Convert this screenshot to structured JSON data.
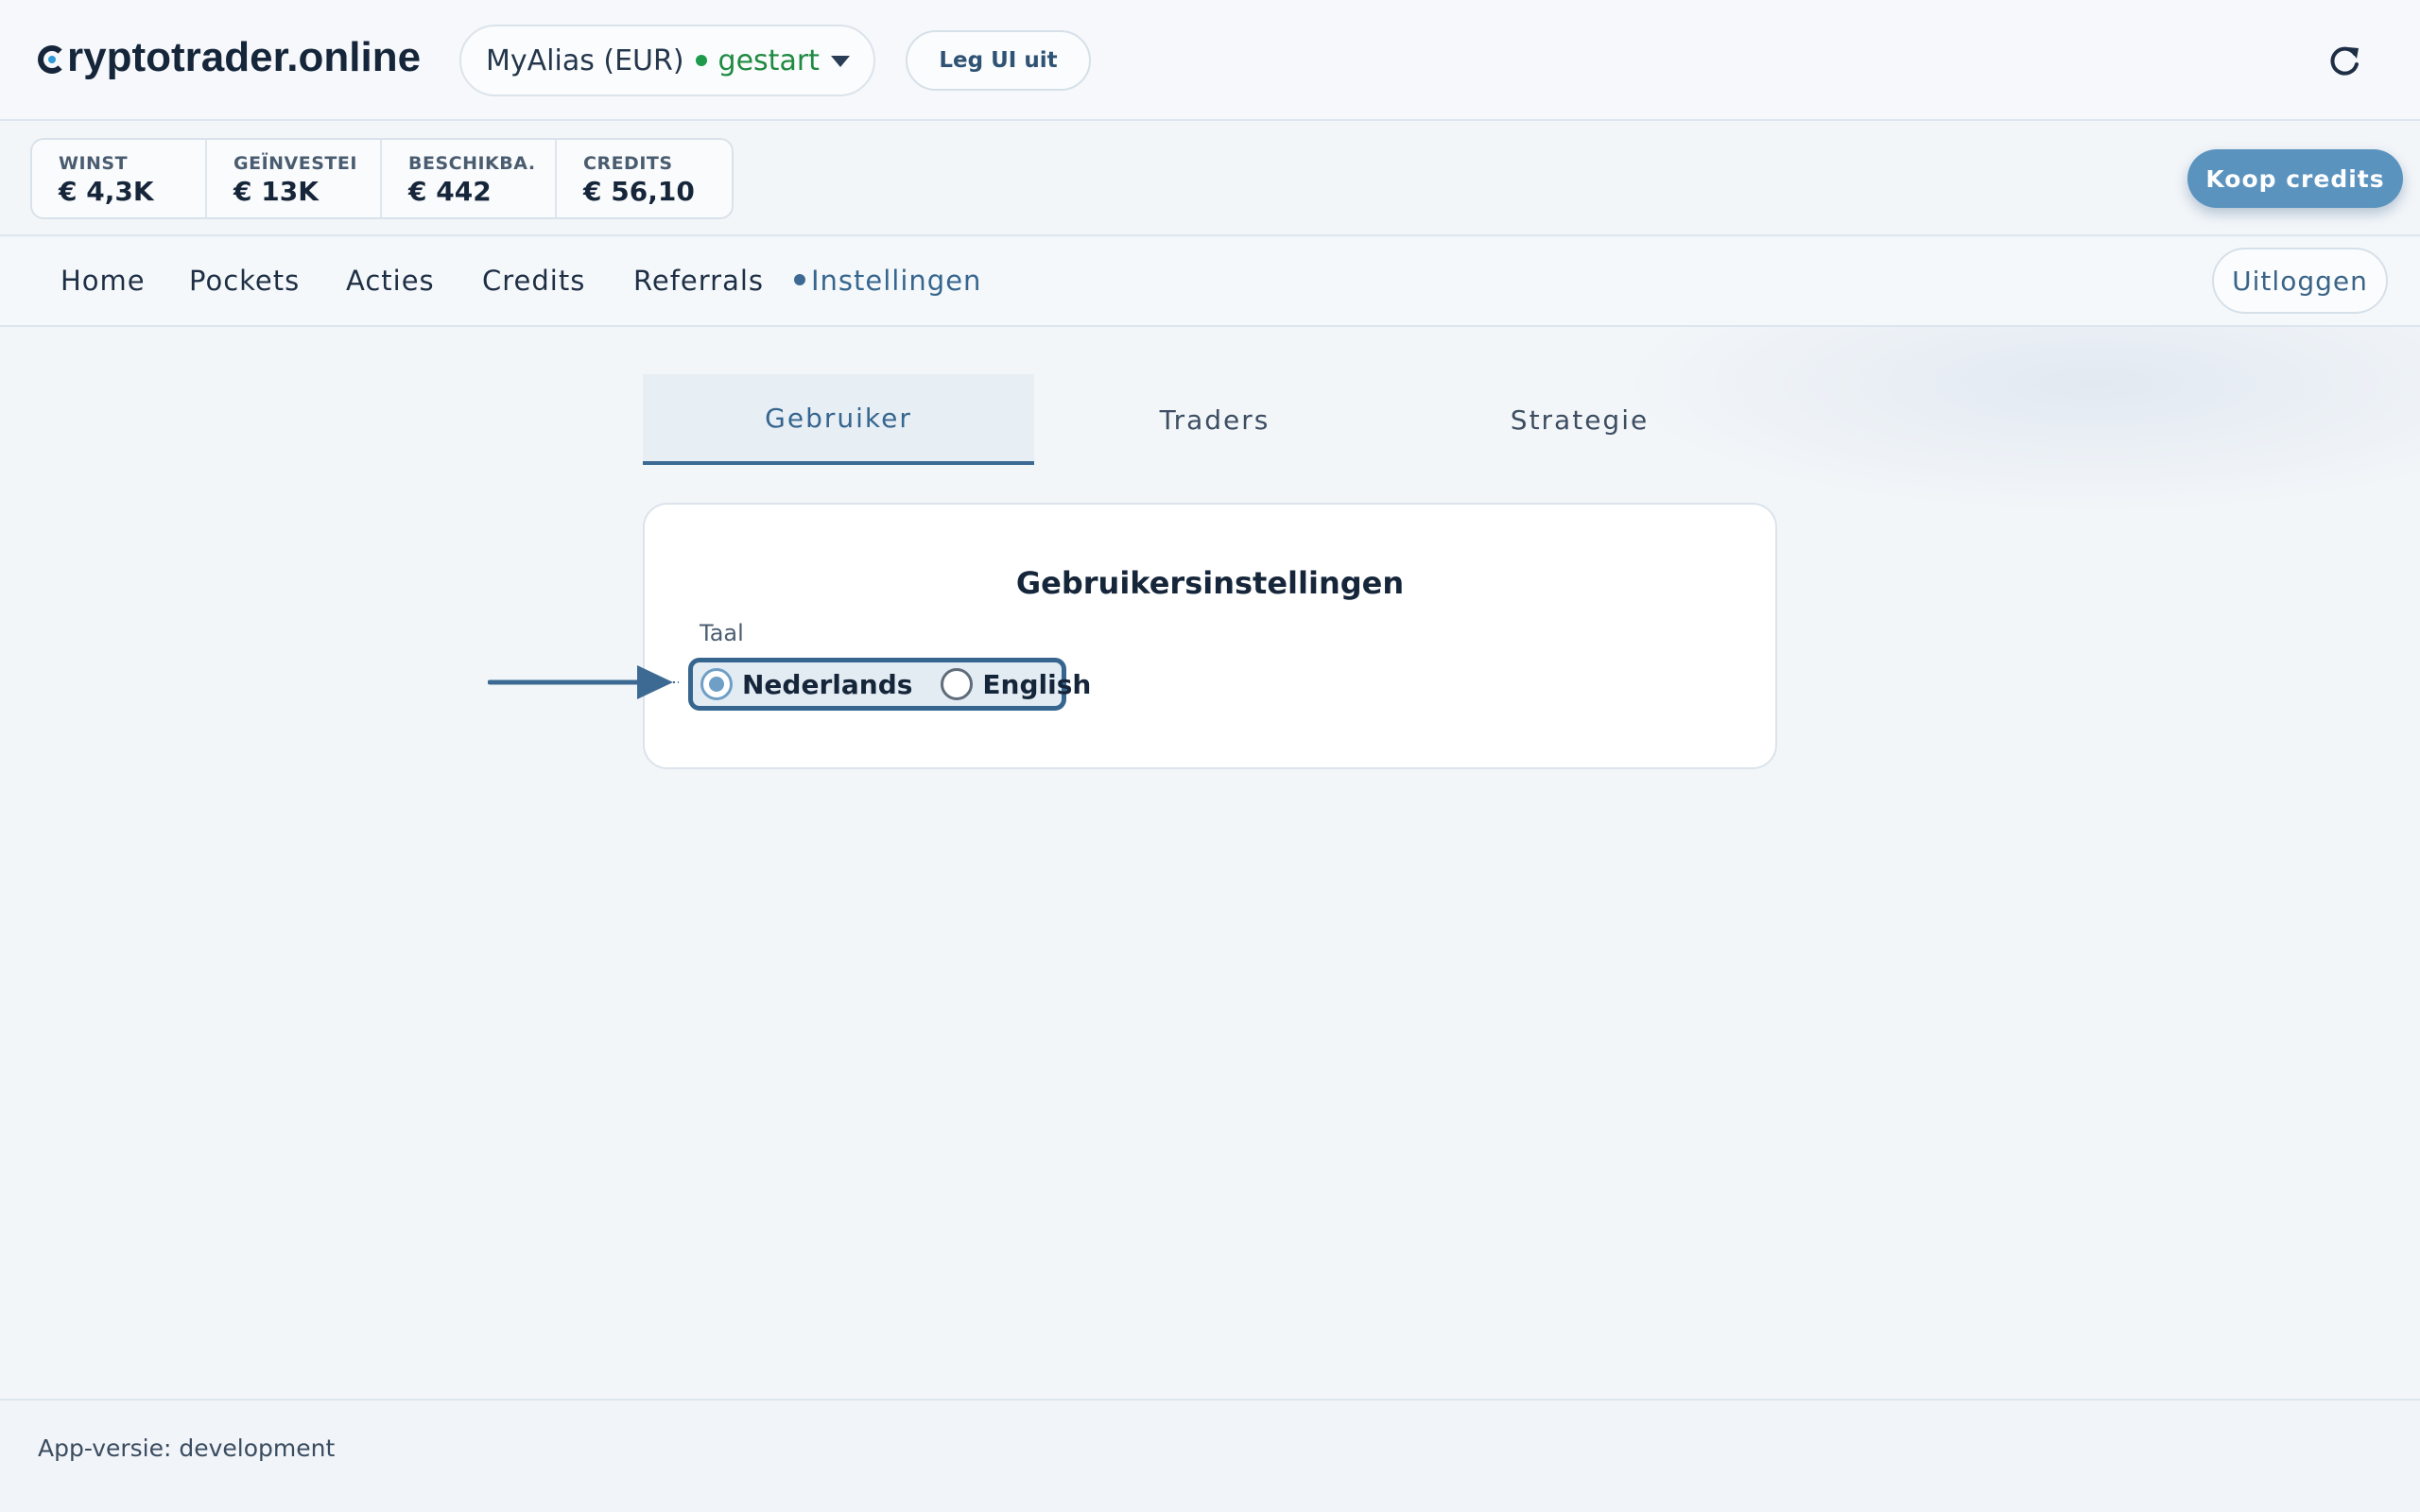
{
  "header": {
    "brand": "ryptotrader.online",
    "account": "MyAlias (EUR)",
    "status": "gestart",
    "explain_button": "Leg UI uit"
  },
  "stats": [
    {
      "label": "WINST",
      "value": "€ 4,3K"
    },
    {
      "label": "GEÏNVESTEI",
      "value": "€ 13K"
    },
    {
      "label": "BESCHIKBA.",
      "value": "€ 442"
    },
    {
      "label": "CREDITS",
      "value": "€ 56,10"
    }
  ],
  "buy_button": "Koop credits",
  "nav": {
    "items": [
      "Home",
      "Pockets",
      "Acties",
      "Credits",
      "Referrals",
      "Instellingen"
    ],
    "active": "Instellingen",
    "logout": "Uitloggen"
  },
  "tabs": [
    "Gebruiker",
    "Traders",
    "Strategie"
  ],
  "active_tab": "Gebruiker",
  "settings": {
    "title": "Gebruikersinstellingen",
    "language_label": "Taal",
    "options": [
      "Nederlands",
      "English"
    ],
    "selected": "Nederlands"
  },
  "footer": {
    "version": "App-versie: development"
  },
  "colors": {
    "accent": "#36668f",
    "status_green": "#1f8a41",
    "buy_button": "#5b93bf"
  }
}
